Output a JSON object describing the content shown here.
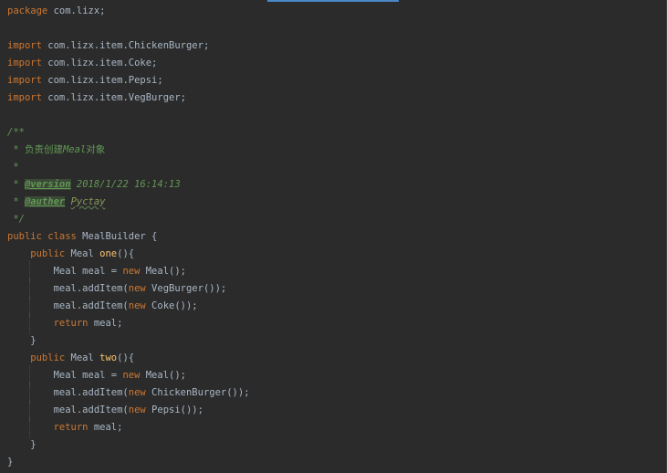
{
  "editor": {
    "lines": [
      [
        {
          "t": "package",
          "c": "keyword"
        },
        {
          "t": " com.lizx;",
          "c": "plain"
        }
      ],
      [],
      [
        {
          "t": "import",
          "c": "keyword"
        },
        {
          "t": " com.lizx.item.ChickenBurger;",
          "c": "plain"
        }
      ],
      [
        {
          "t": "import",
          "c": "keyword"
        },
        {
          "t": " com.lizx.item.Coke;",
          "c": "plain"
        }
      ],
      [
        {
          "t": "import",
          "c": "keyword"
        },
        {
          "t": " com.lizx.item.Pepsi;",
          "c": "plain"
        }
      ],
      [
        {
          "t": "import",
          "c": "keyword"
        },
        {
          "t": " com.lizx.item.VegBurger;",
          "c": "plain"
        }
      ],
      [],
      [
        {
          "t": "/**",
          "c": "comment"
        }
      ],
      [
        {
          "t": " * ",
          "c": "comment"
        },
        {
          "t": "负责创建",
          "c": "comment-cn"
        },
        {
          "t": "Meal",
          "c": "comment"
        },
        {
          "t": "对象",
          "c": "comment-cn"
        }
      ],
      [
        {
          "t": " *",
          "c": "comment"
        }
      ],
      [
        {
          "t": " * ",
          "c": "comment"
        },
        {
          "t": "@version",
          "c": "tag"
        },
        {
          "t": " 2018/1/22 16:14:13",
          "c": "comment"
        }
      ],
      [
        {
          "t": " * ",
          "c": "comment"
        },
        {
          "t": "@auther",
          "c": "tag"
        },
        {
          "t": " ",
          "c": "comment"
        },
        {
          "t": "Pyctay",
          "c": "tagval"
        }
      ],
      [
        {
          "t": " */",
          "c": "comment"
        }
      ],
      [
        {
          "t": "public class",
          "c": "keyword"
        },
        {
          "t": " MealBuilder {",
          "c": "plain"
        }
      ],
      [
        {
          "t": "    public",
          "c": "keyword"
        },
        {
          "t": " Meal ",
          "c": "plain"
        },
        {
          "t": "one",
          "c": "method"
        },
        {
          "t": "(){",
          "c": "plain"
        }
      ],
      [
        {
          "t": "        Meal meal = ",
          "c": "plain"
        },
        {
          "t": "new",
          "c": "keyword"
        },
        {
          "t": " Meal();",
          "c": "plain"
        }
      ],
      [
        {
          "t": "        meal.addItem(",
          "c": "plain"
        },
        {
          "t": "new",
          "c": "keyword"
        },
        {
          "t": " VegBurger());",
          "c": "plain"
        }
      ],
      [
        {
          "t": "        meal.addItem(",
          "c": "plain"
        },
        {
          "t": "new",
          "c": "keyword"
        },
        {
          "t": " Coke());",
          "c": "plain"
        }
      ],
      [
        {
          "t": "        ",
          "c": "plain"
        },
        {
          "t": "return",
          "c": "keyword"
        },
        {
          "t": " meal;",
          "c": "plain"
        }
      ],
      [
        {
          "t": "    }",
          "c": "plain"
        }
      ],
      [
        {
          "t": "    public",
          "c": "keyword"
        },
        {
          "t": " Meal ",
          "c": "plain"
        },
        {
          "t": "two",
          "c": "method"
        },
        {
          "t": "(){",
          "c": "plain"
        }
      ],
      [
        {
          "t": "        Meal meal = ",
          "c": "plain"
        },
        {
          "t": "new",
          "c": "keyword"
        },
        {
          "t": " Meal();",
          "c": "plain"
        }
      ],
      [
        {
          "t": "        meal.addItem(",
          "c": "plain"
        },
        {
          "t": "new",
          "c": "keyword"
        },
        {
          "t": " ChickenBurger());",
          "c": "plain"
        }
      ],
      [
        {
          "t": "        meal.addItem(",
          "c": "plain"
        },
        {
          "t": "new",
          "c": "keyword"
        },
        {
          "t": " Pepsi());",
          "c": "plain"
        }
      ],
      [
        {
          "t": "        ",
          "c": "plain"
        },
        {
          "t": "return",
          "c": "keyword"
        },
        {
          "t": " meal;",
          "c": "plain"
        }
      ],
      [
        {
          "t": "    }",
          "c": "plain"
        }
      ],
      [
        {
          "t": "}",
          "c": "plain"
        }
      ]
    ]
  },
  "colors": {
    "background": "#2b2b2b",
    "keyword": "#cc7832",
    "text": "#a9b7c6",
    "method": "#ffc66d",
    "comment": "#629755",
    "active_tab": "#4a88c7"
  }
}
